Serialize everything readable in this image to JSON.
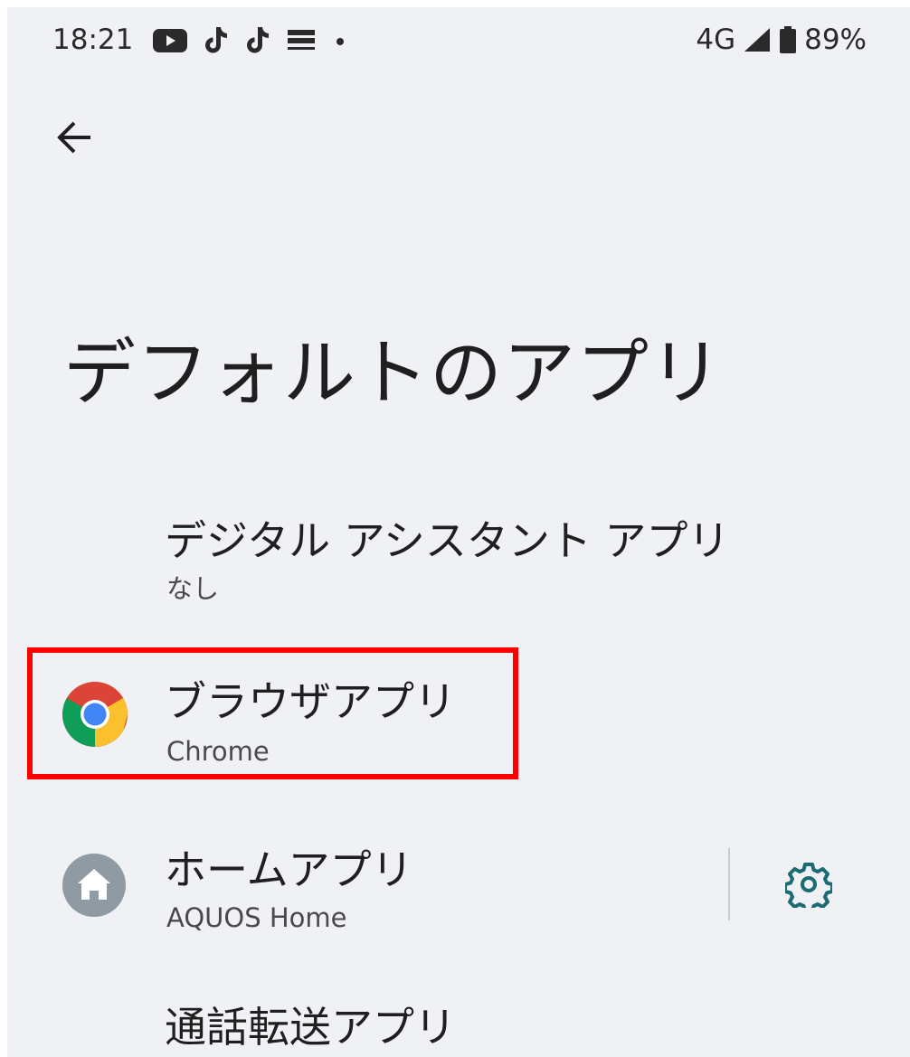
{
  "status_bar": {
    "time": "18:21",
    "icons": [
      "youtube-icon",
      "tiktok-icon",
      "tiktok-icon",
      "familymart-icon",
      "dot-icon"
    ],
    "network": "4G",
    "battery": "89%"
  },
  "page": {
    "title": "デフォルトのアプリ"
  },
  "items": [
    {
      "title": "デジタル アシスタント アプリ",
      "value": "なし",
      "icon": null
    },
    {
      "title": "ブラウザアプリ",
      "value": "Chrome",
      "icon": "chrome-icon"
    },
    {
      "title": "ホームアプリ",
      "value": "AQUOS Home",
      "icon": "home-icon"
    },
    {
      "title": "通話転送アプリ",
      "value": "",
      "icon": null
    }
  ],
  "colors": {
    "background": "#eff1f4",
    "highlight": "#ff0000",
    "settings_accent": "#1b6b73",
    "home_icon_bg": "#8f9aa3"
  }
}
